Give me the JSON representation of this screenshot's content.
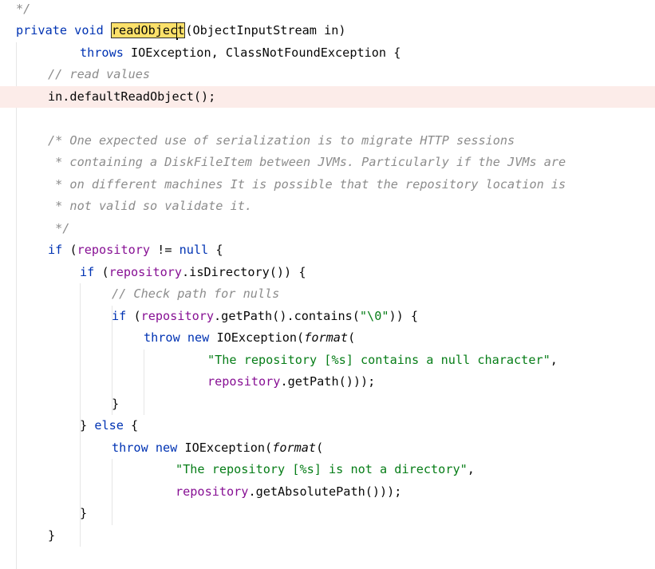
{
  "editor": {
    "lines": [
      {
        "name": "line-1-comment-tail",
        "indent": 0,
        "tokens": [
          [
            "cmt",
            "*/"
          ]
        ]
      },
      {
        "name": "line-2-method-signature",
        "indent": 0,
        "tokens": [
          [
            "kw",
            "private"
          ],
          [
            "",
            "&sp"
          ],
          [
            "kw",
            "void"
          ],
          [
            "",
            "&sp"
          ],
          [
            "hl",
            "readObjec"
          ],
          [
            "caret",
            ""
          ],
          [
            "hlx",
            "t"
          ],
          [
            "",
            "(ObjectInputStream in)"
          ]
        ]
      },
      {
        "name": "line-3-throws",
        "indent": 8,
        "tokens": [
          [
            "kw",
            "throws"
          ],
          [
            "",
            "",
            " IOException, ClassNotFoundException {"
          ]
        ]
      },
      {
        "name": "line-4-comment",
        "indent": 4,
        "tokens": [
          [
            "cmt",
            "// read values"
          ]
        ]
      },
      {
        "name": "line-5-default-read",
        "indent": 4,
        "current": true,
        "tokens": [
          [
            "",
            "in.defaultReadObject();"
          ]
        ]
      },
      {
        "name": "line-6-blank",
        "indent": 0,
        "tokens": []
      },
      {
        "name": "line-7-doc-comment",
        "indent": 4,
        "tokens": [
          [
            "cmt",
            "/* One expected use of serialization is to migrate HTTP sessions"
          ]
        ]
      },
      {
        "name": "line-8-doc-comment",
        "indent": 4,
        "tokens": [
          [
            "cmt",
            " * containing a DiskFileItem between JVMs. Particularly if the JVMs are"
          ]
        ]
      },
      {
        "name": "line-9-doc-comment",
        "indent": 4,
        "tokens": [
          [
            "cmt",
            " * on different machines It is possible that the repository location is"
          ]
        ]
      },
      {
        "name": "line-10-doc-comment",
        "indent": 4,
        "tokens": [
          [
            "cmt",
            " * not valid so validate it."
          ]
        ]
      },
      {
        "name": "line-11-doc-comment-end",
        "indent": 4,
        "tokens": [
          [
            "cmt",
            " */"
          ]
        ]
      },
      {
        "name": "line-12-if-repository",
        "indent": 4,
        "tokens": [
          [
            "kw",
            "if"
          ],
          [
            "",
            "",
            " ("
          ],
          [
            "fld",
            "repository"
          ],
          [
            "",
            "",
            " != "
          ],
          [
            "kw",
            "null"
          ],
          [
            "",
            "",
            " {"
          ]
        ]
      },
      {
        "name": "line-13-if-directory",
        "indent": 8,
        "tokens": [
          [
            "kw",
            "if"
          ],
          [
            "",
            "",
            " ("
          ],
          [
            "fld",
            "repository"
          ],
          [
            "",
            "",
            ".isDirectory()) {"
          ]
        ]
      },
      {
        "name": "line-14-comment",
        "indent": 12,
        "tokens": [
          [
            "cmt",
            "// Check path for nulls"
          ]
        ]
      },
      {
        "name": "line-15-if-contains",
        "indent": 12,
        "tokens": [
          [
            "kw",
            "if"
          ],
          [
            "",
            "",
            " ("
          ],
          [
            "fld",
            "repository"
          ],
          [
            "",
            "",
            ".getPath().contains("
          ],
          [
            "str",
            "\"\\0\""
          ],
          [
            "",
            "",
            "))"
          ],
          [
            "",
            "",
            " {"
          ]
        ]
      },
      {
        "name": "line-16-throw",
        "indent": 16,
        "tokens": [
          [
            "kw",
            "throw"
          ],
          [
            "",
            "",
            " "
          ],
          [
            "kw",
            "new"
          ],
          [
            "",
            "",
            " IOException("
          ],
          [
            "it",
            "format"
          ],
          [
            "",
            "",
            "("
          ]
        ]
      },
      {
        "name": "line-17-string",
        "indent": 24,
        "tokens": [
          [
            "str",
            "\"The repository [%s] contains a null character\""
          ],
          [
            "",
            "",
            ","
          ]
        ]
      },
      {
        "name": "line-18-getpath",
        "indent": 24,
        "tokens": [
          [
            "fld",
            "repository"
          ],
          [
            "",
            "",
            ".getPath()));"
          ]
        ]
      },
      {
        "name": "line-19-close",
        "indent": 12,
        "tokens": [
          [
            "",
            "}"
          ]
        ]
      },
      {
        "name": "line-20-else",
        "indent": 8,
        "tokens": [
          [
            "",
            "}"
          ],
          [
            "",
            "",
            " "
          ],
          [
            "kw",
            "else"
          ],
          [
            "",
            "",
            " {"
          ]
        ]
      },
      {
        "name": "line-21-throw",
        "indent": 12,
        "tokens": [
          [
            "kw",
            "throw"
          ],
          [
            "",
            "",
            " "
          ],
          [
            "kw",
            "new"
          ],
          [
            "",
            "",
            " IOException("
          ],
          [
            "it",
            "format"
          ],
          [
            "",
            "",
            "("
          ]
        ]
      },
      {
        "name": "line-22-string",
        "indent": 20,
        "tokens": [
          [
            "str",
            "\"The repository [%s] is not a directory\""
          ],
          [
            "",
            "",
            ","
          ]
        ]
      },
      {
        "name": "line-23-abs-path",
        "indent": 20,
        "tokens": [
          [
            "fld",
            "repository"
          ],
          [
            "",
            "",
            ".getAbsolutePath()));"
          ]
        ]
      },
      {
        "name": "line-24-close",
        "indent": 8,
        "tokens": [
          [
            "",
            "}"
          ]
        ]
      },
      {
        "name": "line-25-close",
        "indent": 4,
        "tokens": [
          [
            "",
            "}"
          ]
        ]
      }
    ]
  },
  "colors": {
    "keyword": "#0033b3",
    "field": "#871094",
    "string": "#067d17",
    "comment": "#8c8c8c",
    "caret_line": "#fcece9",
    "search_highlight": "#fce16a"
  }
}
